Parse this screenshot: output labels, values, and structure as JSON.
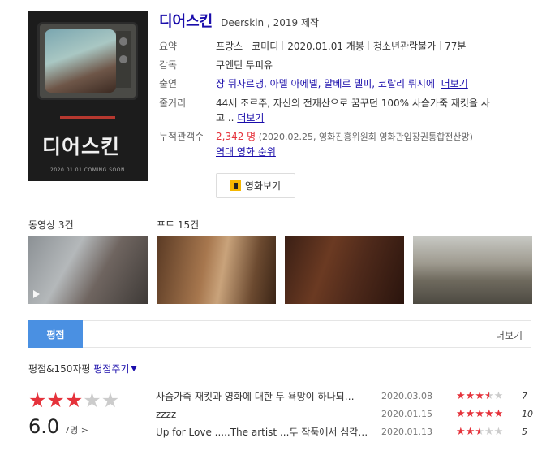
{
  "movie": {
    "title": "디어스킨",
    "subtitle": "Deerskin , 2019 제작",
    "poster_title": "디어스킨",
    "poster_date": "2020.01.01 COMING SOON"
  },
  "info": {
    "summary_label": "요약",
    "summary": [
      "프랑스",
      "코미디",
      "2020.01.01 개봉",
      "청소년관람불가",
      "77분"
    ],
    "director_label": "감독",
    "director": "쿠엔틴 두피유",
    "cast_label": "출연",
    "cast": "장 뒤자르댕, 아델 아에넬, 알베르 델피, 코랄리 뤼시에",
    "cast_more": "더보기",
    "plot_label": "줄거리",
    "plot_line1": "44세 조르주, 자신의 전재산으로 꿈꾸던 100% 사슴가죽 재킷을 사",
    "plot_line2": "고 .. ",
    "plot_more": "더보기",
    "audience_label": "누적관객수",
    "audience_count": "2,342 명",
    "audience_note": " (2020.02.25, 영화진흥위원회 영화관입장권통합전산망)",
    "ranking_link": "역대 영화 순위",
    "watch_button": "영화보기"
  },
  "media": {
    "videos_label": "동영상 3건",
    "photos_label": "포토 15건"
  },
  "ratings": {
    "tab_label": "평점",
    "more_label": "더보기",
    "head_text": "평점&150자평 ",
    "head_link": "평점주기",
    "score": "6.0",
    "count": "7명 >",
    "stars_filled": 3,
    "stars_total": 5,
    "reviews": [
      {
        "text": "사슴가죽 재킷과 영화에 대한 두 욕망이 하나되…",
        "date": "2020.03.08",
        "stars": 3.5,
        "score": "7"
      },
      {
        "text": "zzzz",
        "date": "2020.01.15",
        "stars": 5,
        "score": "10"
      },
      {
        "text": "Up for Love .....The artist ...두 작품에서 심각…",
        "date": "2020.01.13",
        "stars": 2.5,
        "score": "5"
      }
    ]
  },
  "colors": {
    "link": "#1a0dab",
    "accent_red": "#e5323b",
    "tab_blue": "#4a90e2",
    "watch_icon_yellow": "#f5b700"
  }
}
